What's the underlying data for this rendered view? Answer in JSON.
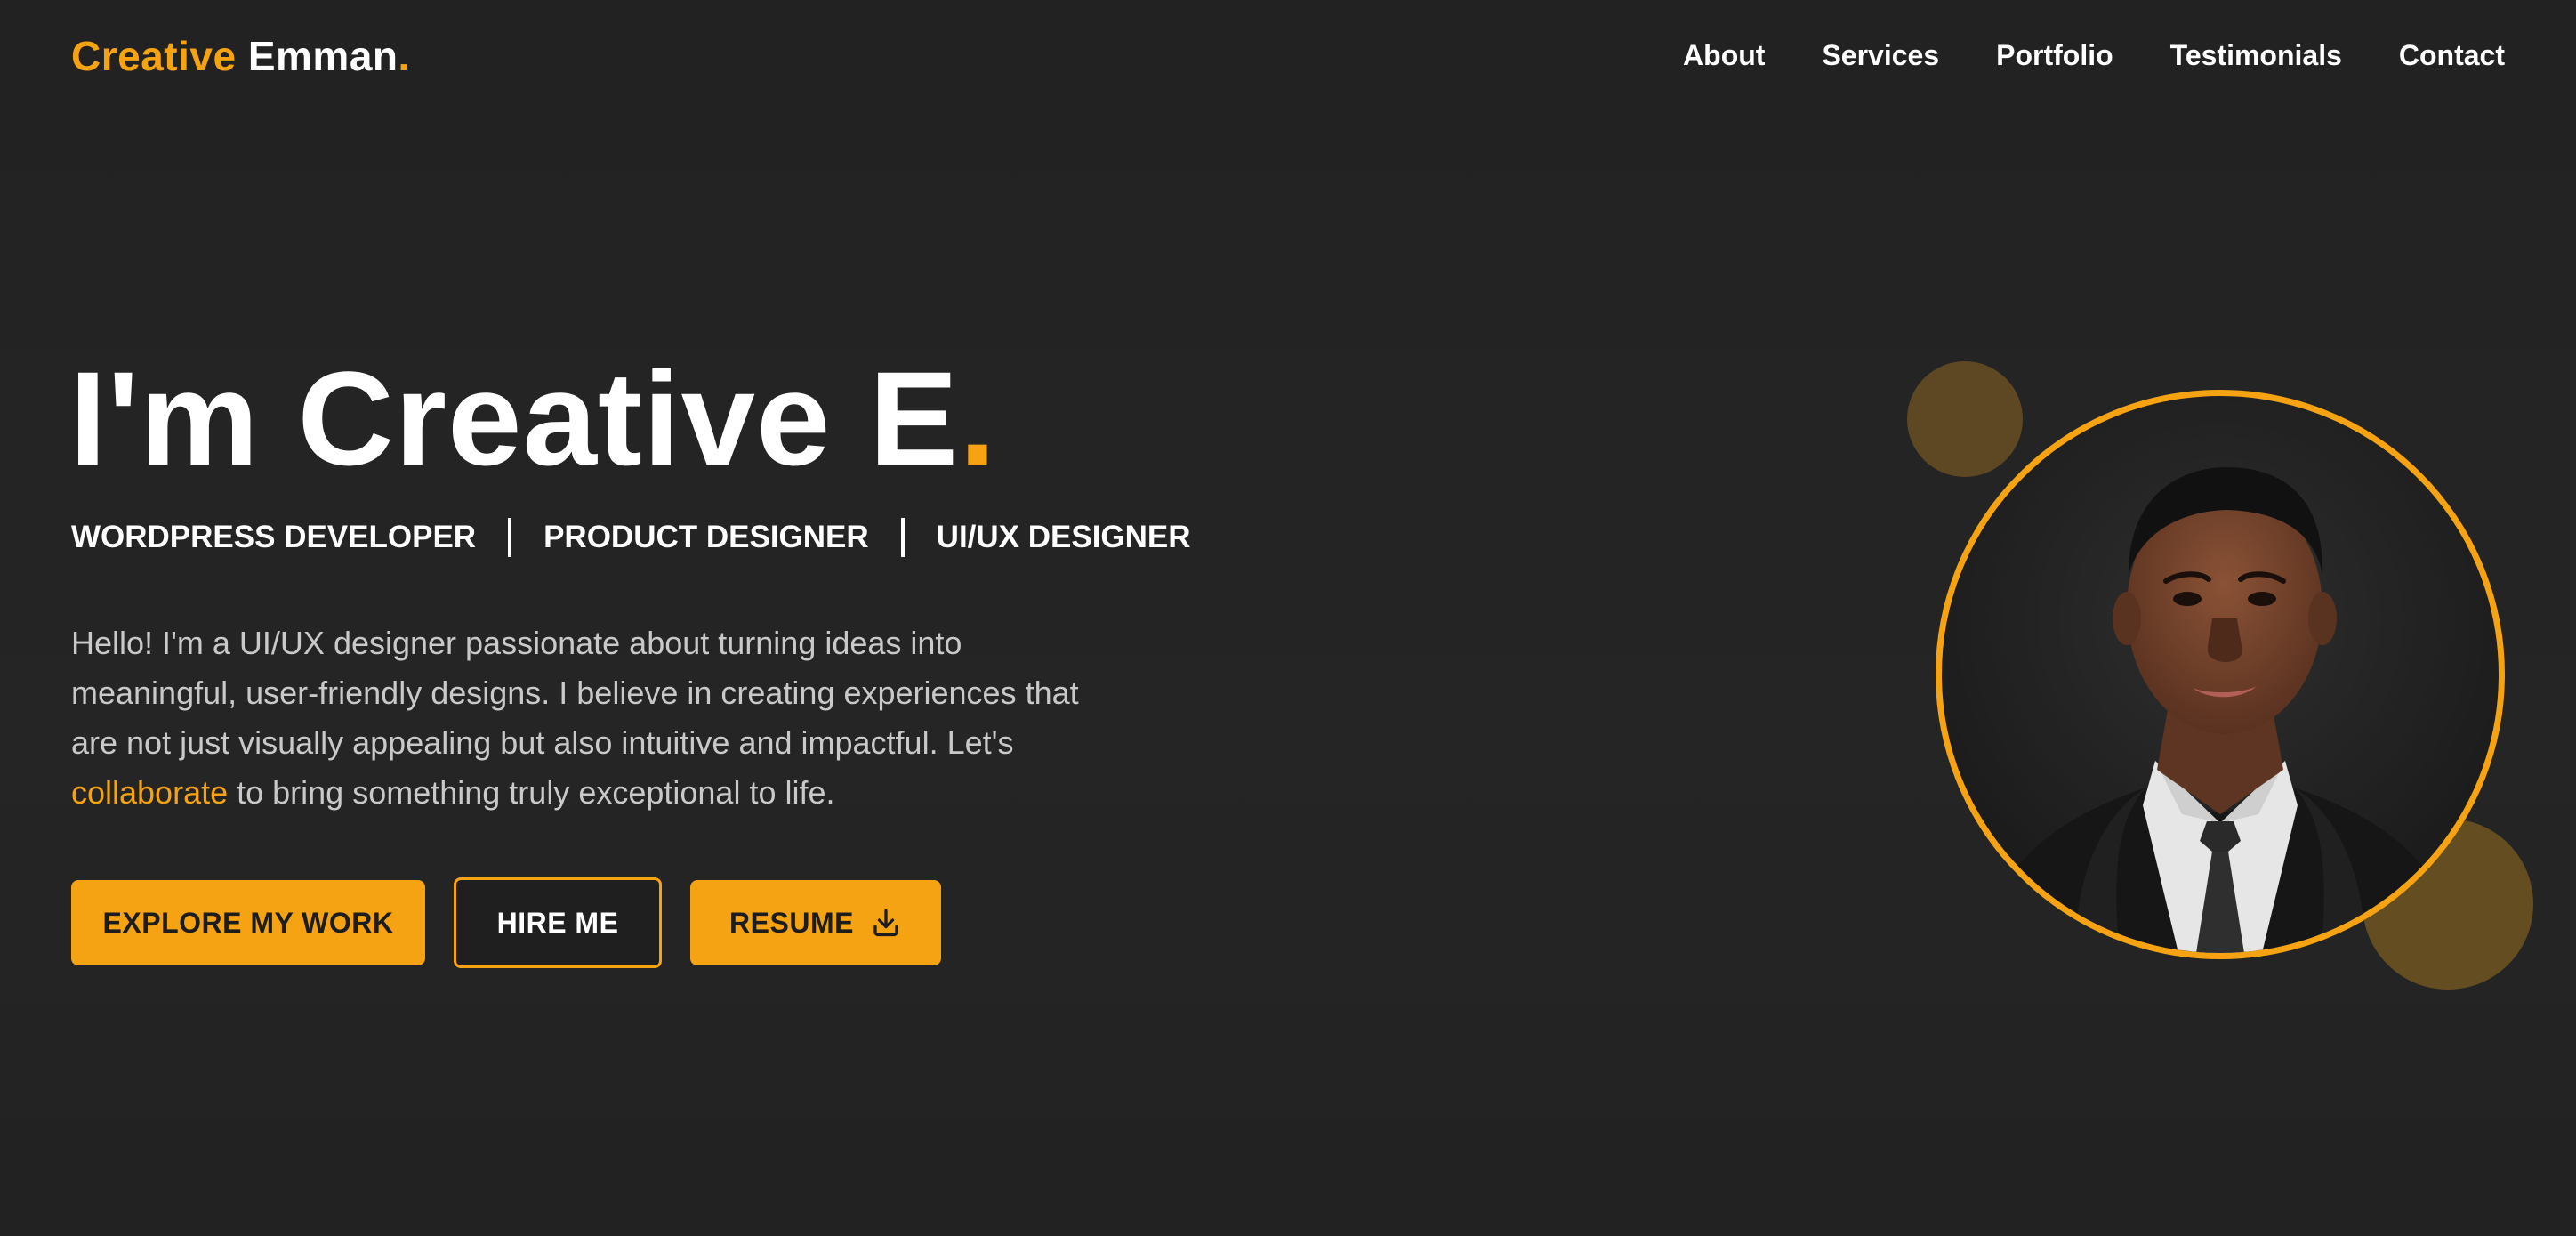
{
  "header": {
    "logo_accent": "Creative",
    "logo_name": "Emman",
    "logo_dot": ".",
    "nav": [
      "About",
      "Services",
      "Portfolio",
      "Testimonials",
      "Contact"
    ]
  },
  "hero": {
    "title": "I'm Creative E",
    "title_dot": ".",
    "roles": [
      "WORDPRESS DEVELOPER",
      "PRODUCT DESIGNER",
      "UI/UX DESIGNER"
    ],
    "intro_before": "Hello! I'm a UI/UX designer passionate about turning ideas into meaningful, user-friendly designs. I believe in creating experiences that are not just visually appealing but also intuitive and impactful. Let's ",
    "intro_link": "collaborate",
    "intro_after": " to bring something truly exceptional to life.",
    "buttons": {
      "explore": "EXPLORE MY WORK",
      "hire": "HIRE ME",
      "resume": "RESUME"
    }
  },
  "icons": {
    "resume": "download-icon",
    "portrait": "person-in-suit"
  },
  "colors": {
    "accent": "#f5a313",
    "background": "#232323",
    "text": "#ffffff",
    "muted_text": "#c9c9c9"
  }
}
